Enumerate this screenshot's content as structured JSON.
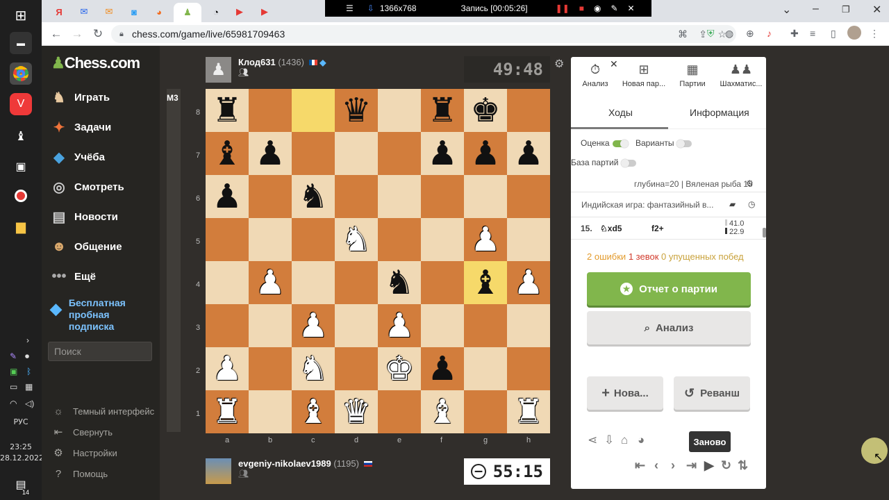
{
  "taskbar": {
    "lang": "РУС",
    "time": "23:25",
    "date": "28.12.2022",
    "notif_count": "14"
  },
  "browser": {
    "url": "chess.com/game/live/65981709463",
    "recording_size": "1366x768",
    "recording_label": "Запись [00:05:26]"
  },
  "sidebar": {
    "logo": "Chess.com",
    "items": [
      {
        "label": "Играть",
        "icon": "play-icon"
      },
      {
        "label": "Задачи",
        "icon": "puzzle-icon"
      },
      {
        "label": "Учёба",
        "icon": "learn-icon"
      },
      {
        "label": "Смотреть",
        "icon": "watch-icon"
      },
      {
        "label": "Новости",
        "icon": "news-icon"
      },
      {
        "label": "Общение",
        "icon": "social-icon"
      },
      {
        "label": "Ещё",
        "icon": "more-icon"
      }
    ],
    "promo": [
      "Бесплатная",
      "пробная",
      "подписка"
    ],
    "search_placeholder": "Поиск",
    "bottom": [
      {
        "label": "Темный интерфейс",
        "icon": "sun-icon"
      },
      {
        "label": "Свернуть",
        "icon": "collapse-icon"
      },
      {
        "label": "Настройки",
        "icon": "settings-icon"
      },
      {
        "label": "Помощь",
        "icon": "help-icon"
      }
    ]
  },
  "game": {
    "eval_label": "M3",
    "top_player": {
      "name": "Клод631",
      "rating": "(1436)",
      "clock": "49:48"
    },
    "bottom_player": {
      "name": "evgeniy-nikolaev1989",
      "rating": "(1195)",
      "clock": "55:15"
    },
    "ranks": [
      "8",
      "7",
      "6",
      "5",
      "4",
      "3",
      "2",
      "1"
    ],
    "files": [
      "a",
      "b",
      "c",
      "d",
      "e",
      "f",
      "g",
      "h"
    ],
    "position": [
      [
        "bR",
        "",
        "",
        "bQ",
        "",
        "bR",
        "bK",
        ""
      ],
      [
        "bB",
        "bP",
        "",
        "",
        "",
        "bP",
        "bP",
        "bP"
      ],
      [
        "bP",
        "",
        "bN",
        "",
        "",
        "",
        "",
        ""
      ],
      [
        "",
        "",
        "",
        "wN",
        "",
        "",
        "wP",
        ""
      ],
      [
        "",
        "wP",
        "",
        "",
        "bN",
        "",
        "bB",
        "wP"
      ],
      [
        "",
        "",
        "wP",
        "",
        "wP",
        "",
        "",
        ""
      ],
      [
        "wP",
        "",
        "wN",
        "",
        "wK",
        "bP",
        "",
        ""
      ],
      [
        "wR",
        "",
        "wB",
        "wQ",
        "",
        "wB",
        "",
        "wR"
      ]
    ],
    "highlight": [
      "c8",
      "g4"
    ]
  },
  "panel": {
    "tabs": [
      {
        "label": "Анализ",
        "icon": "stopwatch-icon"
      },
      {
        "label": "Новая пар...",
        "icon": "plus-square-icon"
      },
      {
        "label": "Партии",
        "icon": "board-icon"
      },
      {
        "label": "Шахматис...",
        "icon": "players-icon"
      }
    ],
    "subtabs": [
      "Ходы",
      "Информация"
    ],
    "toggle_eval": "Оценка",
    "toggle_variants": "Варианты",
    "toggle_db": "База партий",
    "engine": "глубина=20 | Вяленая рыба 15",
    "opening": "Индийская игра: фантазийный в...",
    "move_no": "15.",
    "move_white": "xd5",
    "move_black": "f2+",
    "eval_top": "41.0",
    "eval_bottom": "22.9",
    "summary": {
      "mistakes_n": "2",
      "mistakes": "ошибки",
      "blunders_n": "1",
      "blunders": "зевок",
      "missed_n": "0",
      "missed": "упущенных побед"
    },
    "report_btn": "Отчет о партии",
    "analysis_btn": "Анализ",
    "new_btn": "Нова...",
    "rematch_btn": "Реванш",
    "tooltip": "Заново"
  }
}
